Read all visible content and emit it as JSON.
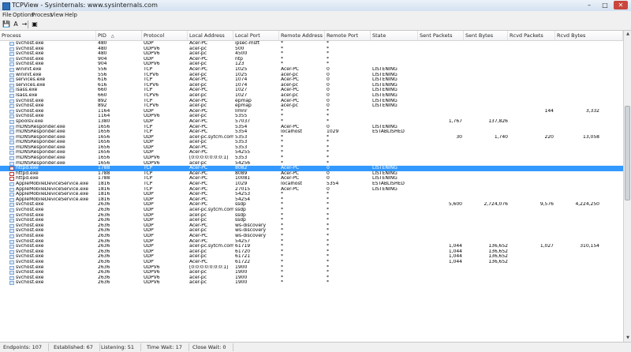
{
  "window": {
    "title": "TCPView - Sysinternals: www.sysinternals.com",
    "buttons": [
      "–",
      "□",
      "✕"
    ]
  },
  "menu": [
    "File",
    "Options",
    "Process",
    "View",
    "Help"
  ],
  "toolbar": {
    "save_glyph": "💾",
    "resolve_glyph": "A",
    "connect_glyph": "→",
    "properties_glyph": "▣"
  },
  "columns": [
    "Process",
    "PID",
    "Protocol",
    "Local Address",
    "Local Port",
    "Remote Address",
    "Remote Port",
    "State",
    "Sent Packets",
    "Sent Bytes",
    "Rcvd Packets",
    "Rcvd Bytes"
  ],
  "sort_indicator": "△",
  "rows": [
    [
      "svchost.exe",
      "480",
      "UDP",
      "Acer-PC",
      "ipsec-msft",
      "*",
      "*",
      "",
      "",
      "",
      "",
      ""
    ],
    [
      "svchost.exe",
      "480",
      "UDPV6",
      "acer-pc",
      "500",
      "*",
      "*",
      "",
      "",
      "",
      "",
      ""
    ],
    [
      "svchost.exe",
      "480",
      "UDPV6",
      "acer-pc",
      "4500",
      "*",
      "*",
      "",
      "",
      "",
      "",
      ""
    ],
    [
      "svchost.exe",
      "904",
      "UDP",
      "Acer-PC",
      "ntp",
      "*",
      "*",
      "",
      "",
      "",
      "",
      ""
    ],
    [
      "svchost.exe",
      "904",
      "UDPV6",
      "acer-pc",
      "123",
      "*",
      "*",
      "",
      "",
      "",
      "",
      ""
    ],
    [
      "wininit.exe",
      "556",
      "TCP",
      "Acer-PC",
      "1025",
      "Acer-PC",
      "0",
      "LISTENING",
      "",
      "",
      "",
      ""
    ],
    [
      "wininit.exe",
      "556",
      "TCPV6",
      "acer-pc",
      "1025",
      "acer-pc",
      "0",
      "LISTENING",
      "",
      "",
      "",
      ""
    ],
    [
      "services.exe",
      "616",
      "TCP",
      "Acer-PC",
      "1074",
      "Acer-PC",
      "0",
      "LISTENING",
      "",
      "",
      "",
      ""
    ],
    [
      "services.exe",
      "616",
      "TCPV6",
      "acer-pc",
      "1074",
      "acer-pc",
      "0",
      "LISTENING",
      "",
      "",
      "",
      ""
    ],
    [
      "lsass.exe",
      "660",
      "TCP",
      "Acer-PC",
      "1027",
      "Acer-PC",
      "0",
      "LISTENING",
      "",
      "",
      "",
      ""
    ],
    [
      "lsass.exe",
      "660",
      "TCPV6",
      "acer-pc",
      "1027",
      "acer-pc",
      "0",
      "LISTENING",
      "",
      "",
      "",
      ""
    ],
    [
      "svchost.exe",
      "892",
      "TCP",
      "Acer-PC",
      "epmap",
      "Acer-PC",
      "0",
      "LISTENING",
      "",
      "",
      "",
      ""
    ],
    [
      "svchost.exe",
      "892",
      "TCPV6",
      "acer-pc",
      "epmap",
      "acer-pc",
      "0",
      "LISTENING",
      "",
      "",
      "",
      ""
    ],
    [
      "svchost.exe",
      "1164",
      "UDP",
      "Acer-PC",
      "llmnr",
      "*",
      "*",
      "",
      "",
      "",
      "144",
      "3,332"
    ],
    [
      "svchost.exe",
      "1164",
      "UDPV6",
      "acer-pc",
      "5355",
      "*",
      "*",
      "",
      "",
      "",
      "",
      ""
    ],
    [
      "spoolsv.exe",
      "1380",
      "UDP",
      "Acer-PC",
      "57037",
      "*",
      "*",
      "",
      "1,767",
      "137,826",
      "",
      ""
    ],
    [
      "mDNSResponder.exe",
      "1656",
      "TCP",
      "Acer-PC",
      "5354",
      "Acer-PC",
      "0",
      "LISTENING",
      "",
      "",
      "",
      ""
    ],
    [
      "mDNSResponder.exe",
      "1656",
      "TCP",
      "Acer-PC",
      "5354",
      "localhost",
      "1029",
      "ESTABLISHED",
      "",
      "",
      "",
      ""
    ],
    [
      "mDNSResponder.exe",
      "1656",
      "UDP",
      "acer-pc.sytcm.com",
      "5353",
      "*",
      "*",
      "",
      "30",
      "1,740",
      "220",
      "13,058"
    ],
    [
      "mDNSResponder.exe",
      "1656",
      "UDP",
      "acer-pc",
      "5353",
      "*",
      "*",
      "",
      "",
      "",
      "",
      ""
    ],
    [
      "mDNSResponder.exe",
      "1656",
      "UDP",
      "Acer-PC",
      "5353",
      "*",
      "*",
      "",
      "",
      "",
      "",
      ""
    ],
    [
      "mDNSResponder.exe",
      "1656",
      "UDP",
      "Acer-PC",
      "54255",
      "*",
      "*",
      "",
      "",
      "",
      "",
      ""
    ],
    [
      "mDNSResponder.exe",
      "1656",
      "UDPV6",
      "[0:0:0:0:0:0:0:1]",
      "5353",
      "*",
      "*",
      "",
      "",
      "",
      "",
      ""
    ],
    [
      "mDNSResponder.exe",
      "1656",
      "UDPV6",
      "acer-pc",
      "54256",
      "*",
      "*",
      "",
      "",
      "",
      "",
      ""
    ],
    [
      "httpd.exe",
      "1788",
      "TCP",
      "Acer-PC",
      "8082",
      "Acer-PC",
      "0",
      "LISTENING",
      "",
      "",
      "",
      ""
    ],
    [
      "httpd.exe",
      "1788",
      "TCP",
      "Acer-PC",
      "8089",
      "Acer-PC",
      "0",
      "LISTENING",
      "",
      "",
      "",
      ""
    ],
    [
      "httpd.exe",
      "1788",
      "TCP",
      "Acer-PC",
      "10081",
      "Acer-PC",
      "0",
      "LISTENING",
      "",
      "",
      "",
      ""
    ],
    [
      "AppleMobileDeviceService.exe",
      "1816",
      "TCP",
      "Acer-PC",
      "1029",
      "localhost",
      "5354",
      "ESTABLISHED",
      "",
      "",
      "",
      ""
    ],
    [
      "AppleMobileDeviceService.exe",
      "1816",
      "TCP",
      "Acer-PC",
      "27015",
      "Acer-PC",
      "0",
      "LISTENING",
      "",
      "",
      "",
      ""
    ],
    [
      "AppleMobileDeviceService.exe",
      "1816",
      "UDP",
      "Acer-PC",
      "54253",
      "*",
      "*",
      "",
      "",
      "",
      "",
      ""
    ],
    [
      "AppleMobileDeviceService.exe",
      "1816",
      "UDP",
      "Acer-PC",
      "54254",
      "*",
      "*",
      "",
      "",
      "",
      "",
      ""
    ],
    [
      "svchost.exe",
      "2636",
      "UDP",
      "Acer-PC",
      "ssdp",
      "*",
      "*",
      "",
      "5,600",
      "2,724,076",
      "9,576",
      "4,224,250"
    ],
    [
      "svchost.exe",
      "2636",
      "UDP",
      "acer-pc.sytcm.com",
      "ssdp",
      "*",
      "*",
      "",
      "",
      "",
      "",
      ""
    ],
    [
      "svchost.exe",
      "2636",
      "UDP",
      "acer-pc",
      "ssdp",
      "*",
      "*",
      "",
      "",
      "",
      "",
      ""
    ],
    [
      "svchost.exe",
      "2636",
      "UDP",
      "acer-pc",
      "ssdp",
      "*",
      "*",
      "",
      "",
      "",
      "",
      ""
    ],
    [
      "svchost.exe",
      "2636",
      "UDP",
      "Acer-PC",
      "ws-discovery",
      "*",
      "*",
      "",
      "",
      "",
      "",
      ""
    ],
    [
      "svchost.exe",
      "2636",
      "UDP",
      "acer-pc",
      "ws-discovery",
      "*",
      "*",
      "",
      "",
      "",
      "",
      ""
    ],
    [
      "svchost.exe",
      "2636",
      "UDP",
      "Acer-PC",
      "ws-discovery",
      "*",
      "*",
      "",
      "",
      "",
      "",
      ""
    ],
    [
      "svchost.exe",
      "2636",
      "UDP",
      "Acer-PC",
      "54257",
      "*",
      "*",
      "",
      "",
      "",
      "",
      ""
    ],
    [
      "svchost.exe",
      "2636",
      "UDP",
      "acer-pc.sytcm.com",
      "61719",
      "*",
      "*",
      "",
      "1,044",
      "136,652",
      "1,027",
      "310,154"
    ],
    [
      "svchost.exe",
      "2636",
      "UDP",
      "acer-pc",
      "61720",
      "*",
      "*",
      "",
      "1,044",
      "136,652",
      "",
      ""
    ],
    [
      "svchost.exe",
      "2636",
      "UDP",
      "acer-pc",
      "61721",
      "*",
      "*",
      "",
      "1,044",
      "136,652",
      "",
      ""
    ],
    [
      "svchost.exe",
      "2636",
      "UDP",
      "Acer-PC",
      "61722",
      "*",
      "*",
      "",
      "1,044",
      "136,652",
      "",
      ""
    ],
    [
      "svchost.exe",
      "2636",
      "UDPV6",
      "[0:0:0:0:0:0:0:1]",
      "1900",
      "*",
      "*",
      "",
      "",
      "",
      "",
      ""
    ],
    [
      "svchost.exe",
      "2636",
      "UDPV6",
      "acer-pc",
      "1900",
      "*",
      "*",
      "",
      "",
      "",
      "",
      ""
    ],
    [
      "svchost.exe",
      "2636",
      "UDPV6",
      "acer-pc",
      "1900",
      "*",
      "*",
      "",
      "",
      "",
      "",
      ""
    ],
    [
      "svchost.exe",
      "2636",
      "UDPV6",
      "acer-pc",
      "1900",
      "*",
      "*",
      "",
      "",
      "",
      "",
      ""
    ]
  ],
  "selected_row": 24,
  "status": {
    "endpoints": "Endpoints: 107",
    "established": "Established: 67",
    "listening": "Listening: 51",
    "time_wait": "Time Wait: 17",
    "close_wait": "Close Wait: 0"
  },
  "colors": {
    "selection": "#3399ff",
    "icon_border": "#7ea7d8",
    "http_icon": "#b33333"
  }
}
